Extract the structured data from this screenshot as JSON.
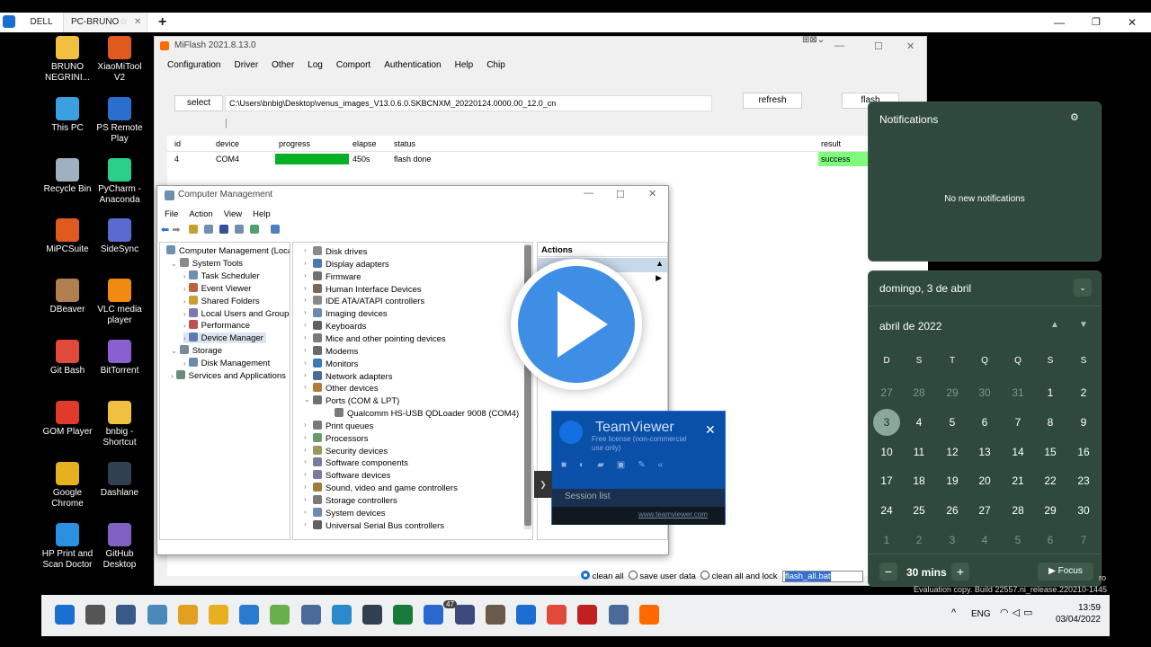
{
  "teamviewer_tabs": [
    {
      "label": "DELL"
    },
    {
      "label": "PC-BRUNO"
    }
  ],
  "desktop_icons": [
    {
      "label": "BRUNO NEGRINI...",
      "color": "#f0c040"
    },
    {
      "label": "XiaoMiTool V2",
      "color": "#e05a20"
    },
    {
      "label": "This PC",
      "color": "#3aa0e0"
    },
    {
      "label": "PS Remote Play",
      "color": "#2a6fd0"
    },
    {
      "label": "Recycle Bin",
      "color": "#a0b0c0"
    },
    {
      "label": "PyCharm - Anaconda",
      "color": "#2ad08a"
    },
    {
      "label": "MiPCSuite",
      "color": "#e05a20"
    },
    {
      "label": "SideSync",
      "color": "#5a6ad0"
    },
    {
      "label": "DBeaver",
      "color": "#b08050"
    },
    {
      "label": "VLC media player",
      "color": "#f08a10"
    },
    {
      "label": "Git Bash",
      "color": "#e04a3a"
    },
    {
      "label": "BitTorrent",
      "color": "#8a60d0"
    },
    {
      "label": "GOM Player",
      "color": "#e03a2a"
    },
    {
      "label": "bnbig - Shortcut",
      "color": "#f0c040"
    },
    {
      "label": "Google Chrome",
      "color": "#e8b020"
    },
    {
      "label": "Dashlane",
      "color": "#304050"
    },
    {
      "label": "HP Print and Scan Doctor",
      "color": "#2a90e0"
    },
    {
      "label": "GitHub Desktop",
      "color": "#8060c0"
    }
  ],
  "miflash": {
    "title": "MiFlash 2021.8.13.0",
    "menu": [
      "Configuration",
      "Driver",
      "Other",
      "Log",
      "Comport",
      "Authentication",
      "Help",
      "Chip"
    ],
    "select_label": "select",
    "path": "C:\\Users\\bnbig\\Desktop\\venus_images_V13.0.6.0.SKBCNXM_20220124.0000.00_12.0_cn",
    "refresh_label": "refresh",
    "flash_label": "flash",
    "columns": {
      "id": "id",
      "device": "device",
      "progress": "progress",
      "elapse": "elapse",
      "status": "status",
      "result": "result"
    },
    "row": {
      "id": "4",
      "device": "COM4",
      "progress": 1.0,
      "elapse": "450s",
      "status": "flash done",
      "result": "success"
    },
    "options": [
      "clean all",
      "save user data",
      "clean all and lock"
    ],
    "script": "flash_all.bat"
  },
  "cm": {
    "title": "Computer Management",
    "menu": [
      "File",
      "Action",
      "View",
      "Help"
    ],
    "tree": [
      "Computer Management (Local)",
      "System Tools",
      "Task Scheduler",
      "Event Viewer",
      "Shared Folders",
      "Local Users and Groups",
      "Performance",
      "Device Manager",
      "Storage",
      "Disk Management",
      "Services and Applications"
    ],
    "devices": [
      "Disk drives",
      "Display adapters",
      "Firmware",
      "Human Interface Devices",
      "IDE ATA/ATAPI controllers",
      "Imaging devices",
      "Keyboards",
      "Mice and other pointing devices",
      "Modems",
      "Monitors",
      "Network adapters",
      "Other devices",
      "Ports (COM & LPT)",
      "Qualcomm HS-USB QDLoader 9008 (COM4)",
      "Print queues",
      "Processors",
      "Security devices",
      "Software components",
      "Software devices",
      "Sound, video and game controllers",
      "Storage controllers",
      "System devices",
      "Universal Serial Bus controllers"
    ],
    "actions_title": "Actions"
  },
  "teamviewer_panel": {
    "brand": "TeamViewer",
    "subtitle": "Free license (non-commercial use only)",
    "session": "Session list",
    "url": "www.teamviewer.com"
  },
  "notifications": {
    "title": "Notifications",
    "empty": "No new notifications"
  },
  "calendar": {
    "date_header": "domingo, 3 de abril",
    "month": "abril de 2022",
    "weekdays": [
      "D",
      "S",
      "T",
      "Q",
      "Q",
      "S",
      "S"
    ],
    "days": [
      "27",
      "28",
      "29",
      "30",
      "31",
      "1",
      "2",
      "3",
      "4",
      "5",
      "6",
      "7",
      "8",
      "9",
      "10",
      "11",
      "12",
      "13",
      "14",
      "15",
      "16",
      "17",
      "18",
      "19",
      "20",
      "21",
      "22",
      "23",
      "24",
      "25",
      "26",
      "27",
      "28",
      "29",
      "30",
      "1",
      "2",
      "3",
      "4",
      "5",
      "6",
      "7"
    ],
    "focus_duration": "30 mins",
    "focus_label": "Focus"
  },
  "watermark": "Evaluation copy. Build 22557.ni_release.220210-1445",
  "watermark_tail": "ro",
  "tray": {
    "lang": "ENG",
    "time": "13:59",
    "date": "03/04/2022",
    "badge": "47"
  }
}
